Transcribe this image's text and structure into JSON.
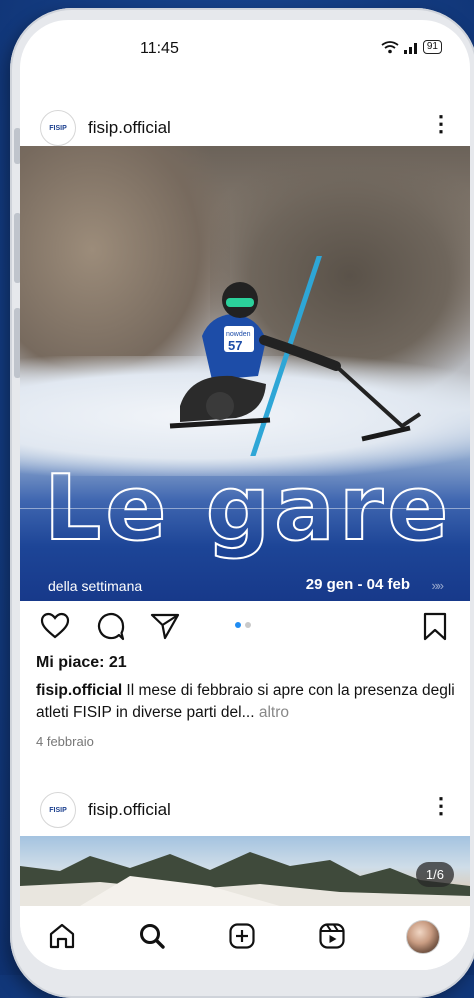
{
  "status_bar": {
    "time": "11:45",
    "battery": "91"
  },
  "post1": {
    "username": "fisip.official",
    "logo_text": "FISIP",
    "image": {
      "title_word1": "Le",
      "title_word2": "gare",
      "subtitle": "della settimana",
      "dates": "29 gen - 04 feb",
      "arrows": "»»",
      "bib_text": "nowden",
      "bib_number": "57"
    },
    "carousel": {
      "pages": 2,
      "active_page": 1
    },
    "likes": "Mi piace: 21",
    "caption_user": "fisip.official",
    "caption_text": " Il mese di febbraio si apre con la presenza degli atleti FISIP in diverse parti del...",
    "caption_more": " altro",
    "date": "4 febbraio"
  },
  "post2": {
    "username": "fisip.official",
    "logo_text": "FISIP",
    "counter": "1/6"
  },
  "icons": {
    "like": "heart-icon",
    "comment": "comment-icon",
    "share": "send-icon",
    "save": "bookmark-icon",
    "home": "home-icon",
    "search": "search-icon",
    "create": "plus-square-icon",
    "reels": "reels-icon",
    "profile": "profile-avatar"
  },
  "colors": {
    "accent_blue": "#1f8cf2",
    "brand_blue": "#17398a"
  }
}
